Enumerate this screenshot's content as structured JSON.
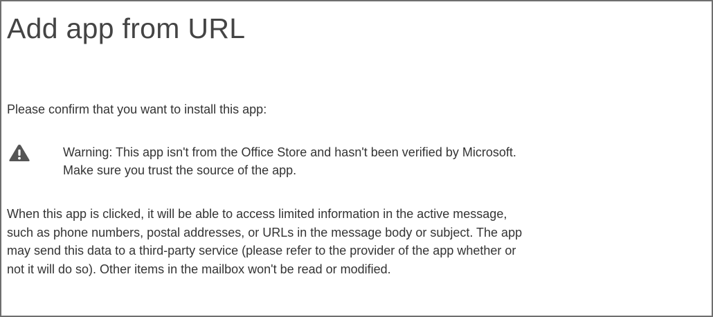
{
  "dialog": {
    "title": "Add app from URL",
    "confirm_text": "Please confirm that you want to install this app:",
    "warning": {
      "icon": "warning-triangle-icon",
      "line1": "Warning: This app isn't from the Office Store and hasn't been verified by Microsoft.",
      "line2": "Make sure you trust the source of the app."
    },
    "info_lines": [
      "When this app is clicked, it will be able to access limited information in the active message,",
      "such as phone numbers, postal addresses, or URLs in the message body or subject. The app",
      "may send this data to a third-party service (please refer to the provider of the app whether or",
      "not it will do so). Other items in the mailbox won't be read or modified."
    ]
  }
}
